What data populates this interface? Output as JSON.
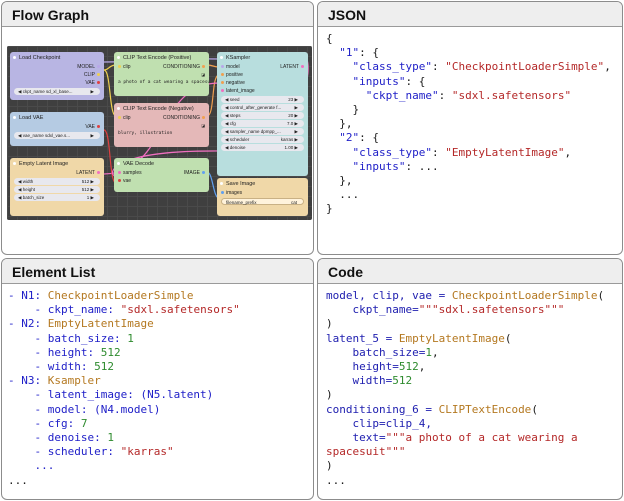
{
  "panels": {
    "flow_title": "Flow Graph",
    "json_title": "JSON",
    "elements_title": "Element List",
    "code_title": "Code"
  },
  "graph": {
    "ckpt": {
      "title": "Load Checkpoint",
      "out_model": "MODEL",
      "out_clip": "CLIP",
      "out_vae": "VAE",
      "widget": "ckpt_name  sd_xl_base..."
    },
    "vae": {
      "title": "Load VAE",
      "out_vae": "VAE",
      "widget": "vae_name  sdxl_vae.s..."
    },
    "latent": {
      "title": "Empty Latent Image",
      "out": "LATENT",
      "w1": "width",
      "v1": "512",
      "w2": "height",
      "v2": "512",
      "w3": "batch_size",
      "v3": "1"
    },
    "pos": {
      "title": "CLIP Text Encode (Positive)",
      "in": "clip",
      "out": "CONDITIONING",
      "text": "a photo of a cat wearing a spacesuit"
    },
    "neg": {
      "title": "CLIP Text Encode (Negative)",
      "in": "clip",
      "out": "CONDITIONING",
      "text": "blurry, illustration"
    },
    "dec": {
      "title": "VAE Decode",
      "in1": "samples",
      "in2": "vae",
      "out": "IMAGE"
    },
    "ks": {
      "title": "KSampler",
      "out": "LATENT",
      "in1": "model",
      "in2": "positive",
      "in3": "negative",
      "in4": "latent_image",
      "w1": "seed",
      "v1": "23",
      "w2": "control_after_generate  f...",
      "v2": "",
      "w3": "steps",
      "v3": "20",
      "w4": "cfg",
      "v4": "7.0",
      "w5": "sampler_name  dpmpp_...",
      "v5": "",
      "w6": "scheduler",
      "v6": "karras",
      "w7": "denoise",
      "v7": "1.00"
    },
    "save": {
      "title": "Save Image",
      "in": "images",
      "widget": "filename_prefix",
      "widget_val": "cat"
    }
  },
  "json_lines": [
    [
      {
        "t": "{",
        "c": "c-blk"
      }
    ],
    [
      {
        "t": "  ",
        "c": "c-blk"
      },
      {
        "t": "\"1\"",
        "c": "c-key"
      },
      {
        "t": ": {",
        "c": "c-blk"
      }
    ],
    [
      {
        "t": "    ",
        "c": "c-blk"
      },
      {
        "t": "\"class_type\"",
        "c": "c-key"
      },
      {
        "t": ": ",
        "c": "c-blk"
      },
      {
        "t": "\"CheckpointLoaderSimple\"",
        "c": "c-str"
      },
      {
        "t": ",",
        "c": "c-blk"
      }
    ],
    [
      {
        "t": "    ",
        "c": "c-blk"
      },
      {
        "t": "\"inputs\"",
        "c": "c-key"
      },
      {
        "t": ": {",
        "c": "c-blk"
      }
    ],
    [
      {
        "t": "      ",
        "c": "c-blk"
      },
      {
        "t": "\"ckpt_name\"",
        "c": "c-key"
      },
      {
        "t": ": ",
        "c": "c-blk"
      },
      {
        "t": "\"sdxl.safetensors\"",
        "c": "c-str"
      }
    ],
    [
      {
        "t": "    }",
        "c": "c-blk"
      }
    ],
    [
      {
        "t": "  },",
        "c": "c-blk"
      }
    ],
    [
      {
        "t": "  ",
        "c": "c-blk"
      },
      {
        "t": "\"2\"",
        "c": "c-key"
      },
      {
        "t": ": {",
        "c": "c-blk"
      }
    ],
    [
      {
        "t": "    ",
        "c": "c-blk"
      },
      {
        "t": "\"class_type\"",
        "c": "c-key"
      },
      {
        "t": ": ",
        "c": "c-blk"
      },
      {
        "t": "\"EmptyLatentImage\"",
        "c": "c-str"
      },
      {
        "t": ",",
        "c": "c-blk"
      }
    ],
    [
      {
        "t": "    ",
        "c": "c-blk"
      },
      {
        "t": "\"inputs\"",
        "c": "c-key"
      },
      {
        "t": ": ...",
        "c": "c-blk"
      }
    ],
    [
      {
        "t": "  },",
        "c": "c-blk"
      }
    ],
    [
      {
        "t": "  ...",
        "c": "c-blk"
      }
    ],
    [
      {
        "t": "}",
        "c": "c-blk"
      }
    ]
  ],
  "element_lines": [
    [
      {
        "t": "- N1: ",
        "c": "c-key"
      },
      {
        "t": "CheckpointLoaderSimple",
        "c": "c-cls"
      }
    ],
    [
      {
        "t": "    - ckpt_name: ",
        "c": "c-key"
      },
      {
        "t": "\"sdxl.safetensors\"",
        "c": "c-str"
      }
    ],
    [
      {
        "t": "- N2: ",
        "c": "c-key"
      },
      {
        "t": "EmptyLatentImage",
        "c": "c-cls"
      }
    ],
    [
      {
        "t": "    - batch_size: ",
        "c": "c-key"
      },
      {
        "t": "1",
        "c": "c-num"
      }
    ],
    [
      {
        "t": "    - height: ",
        "c": "c-key"
      },
      {
        "t": "512",
        "c": "c-num"
      }
    ],
    [
      {
        "t": "    - width: ",
        "c": "c-key"
      },
      {
        "t": "512",
        "c": "c-num"
      }
    ],
    [
      {
        "t": "- N3: ",
        "c": "c-key"
      },
      {
        "t": "Ksampler",
        "c": "c-cls"
      }
    ],
    [
      {
        "t": "    - latent_image: (N5.latent)",
        "c": "c-key"
      }
    ],
    [
      {
        "t": "    - model: (N4.model)",
        "c": "c-key"
      }
    ],
    [
      {
        "t": "    - cfg: ",
        "c": "c-key"
      },
      {
        "t": "7",
        "c": "c-num"
      }
    ],
    [
      {
        "t": "    - denoise: ",
        "c": "c-key"
      },
      {
        "t": "1",
        "c": "c-num"
      }
    ],
    [
      {
        "t": "    - scheduler: ",
        "c": "c-key"
      },
      {
        "t": "\"karras\"",
        "c": "c-str"
      }
    ],
    [
      {
        "t": "    ...",
        "c": "c-key"
      }
    ],
    [
      {
        "t": "...",
        "c": "c-blk"
      }
    ]
  ],
  "code_lines": [
    [
      {
        "t": "model, clip, vae = ",
        "c": "c-var"
      },
      {
        "t": "CheckpointLoaderSimple",
        "c": "c-cls"
      },
      {
        "t": "(",
        "c": "c-blk"
      }
    ],
    [
      {
        "t": "    ckpt_name=",
        "c": "c-var"
      },
      {
        "t": "\"\"\"sdxl.safetensors\"\"\"",
        "c": "c-str"
      }
    ],
    [
      {
        "t": ")",
        "c": "c-blk"
      }
    ],
    [
      {
        "t": "latent_5 = ",
        "c": "c-var"
      },
      {
        "t": "EmptyLatentImage",
        "c": "c-cls"
      },
      {
        "t": "(",
        "c": "c-blk"
      }
    ],
    [
      {
        "t": "    batch_size=",
        "c": "c-var"
      },
      {
        "t": "1",
        "c": "c-num"
      },
      {
        "t": ",",
        "c": "c-blk"
      }
    ],
    [
      {
        "t": "    height=",
        "c": "c-var"
      },
      {
        "t": "512",
        "c": "c-num"
      },
      {
        "t": ",",
        "c": "c-blk"
      }
    ],
    [
      {
        "t": "    width=",
        "c": "c-var"
      },
      {
        "t": "512",
        "c": "c-num"
      }
    ],
    [
      {
        "t": ")",
        "c": "c-blk"
      }
    ],
    [
      {
        "t": "conditioning_6 = ",
        "c": "c-var"
      },
      {
        "t": "CLIPTextEncode",
        "c": "c-cls"
      },
      {
        "t": "(",
        "c": "c-blk"
      }
    ],
    [
      {
        "t": "    clip=clip_4,",
        "c": "c-var"
      }
    ],
    [
      {
        "t": "    text=",
        "c": "c-var"
      },
      {
        "t": "\"\"\"a photo of a cat wearing a",
        "c": "c-str"
      }
    ],
    [
      {
        "t": "spacesuit\"\"\"",
        "c": "c-str"
      }
    ],
    [
      {
        "t": ")",
        "c": "c-blk"
      }
    ],
    [
      {
        "t": "...",
        "c": "c-blk"
      }
    ]
  ]
}
